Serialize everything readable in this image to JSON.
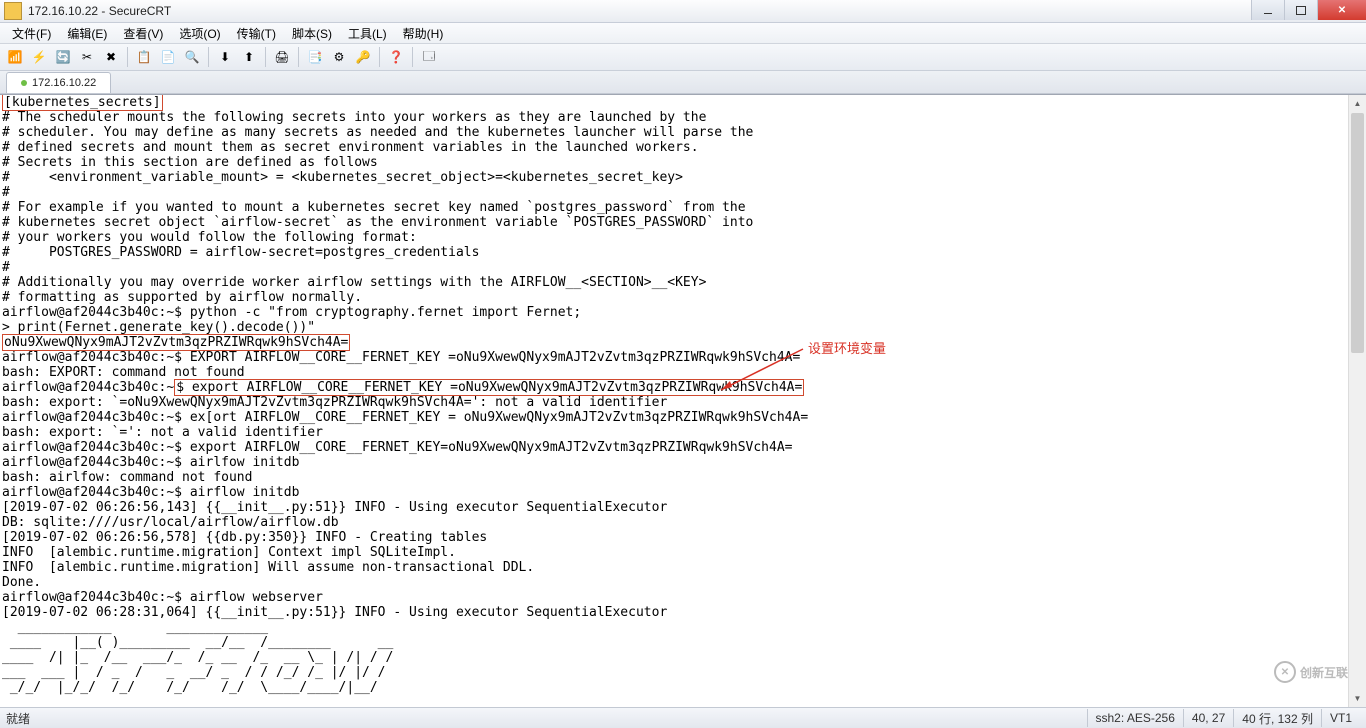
{
  "title": "172.16.10.22 - SecureCRT",
  "menu": [
    "文件(F)",
    "编辑(E)",
    "查看(V)",
    "选项(O)",
    "传输(T)",
    "脚本(S)",
    "工具(L)",
    "帮助(H)"
  ],
  "tab": {
    "label": "172.16.10.22"
  },
  "terminal": {
    "header_line": "[kubernetes_secrets]",
    "comment1": "# The scheduler mounts the following secrets into your workers as they are launched by the",
    "comment2": "# scheduler. You may define as many secrets as needed and the kubernetes launcher will parse the",
    "comment3": "# defined secrets and mount them as secret environment variables in the launched workers.",
    "comment4": "# Secrets in this section are defined as follows",
    "comment5": "#     <environment_variable_mount> = <kubernetes_secret_object>=<kubernetes_secret_key>",
    "comment6": "#",
    "comment7": "# For example if you wanted to mount a kubernetes secret key named `postgres_password` from the",
    "comment8": "# kubernetes secret object `airflow-secret` as the environment variable `POSTGRES_PASSWORD` into",
    "comment9": "# your workers you would follow the following format:",
    "comment10": "#     POSTGRES_PASSWORD = airflow-secret=postgres_credentials",
    "comment11": "#",
    "comment12": "# Additionally you may override worker airflow settings with the AIRFLOW__<SECTION>__<KEY>",
    "comment13": "# formatting as supported by airflow normally.",
    "line_py": "airflow@af2044c3b40c:~$ python -c \"from cryptography.fernet import Fernet;",
    "line_py2": "> print(Fernet.generate_key().decode())\"",
    "boxed_key": "oNu9XwewQNyx9mAJT2vZvtm3qzPRZIWRqwk9hSVch4A=",
    "line_bad1": "airflow@af2044c3b40c:~$ EXPORT AIRFLOW__CORE__FERNET_KEY =oNu9XwewQNyx9mAJT2vZvtm3qzPRZIWRqwk9hSVch4A=",
    "line_bad1_err": "bash: EXPORT: command not found",
    "boxed_export_pre": "airflow@af2044c3b40c:~",
    "boxed_export": "$ export AIRFLOW__CORE__FERNET_KEY =oNu9XwewQNyx9mAJT2vZvtm3qzPRZIWRqwk9hSVch4A=",
    "line_bad2_err": "bash: export: `=oNu9XwewQNyx9mAJT2vZvtm3qzPRZIWRqwk9hSVch4A=': not a valid identifier",
    "line_bad3": "airflow@af2044c3b40c:~$ ex[ort AIRFLOW__CORE__FERNET_KEY = oNu9XwewQNyx9mAJT2vZvtm3qzPRZIWRqwk9hSVch4A=",
    "line_bad3_err": "bash: export: `=': not a valid identifier",
    "line_ok": "airflow@af2044c3b40c:~$ export AIRFLOW__CORE__FERNET_KEY=oNu9XwewQNyx9mAJT2vZvtm3qzPRZIWRqwk9hSVch4A=",
    "line_bad4": "airflow@af2044c3b40c:~$ airlfow initdb",
    "line_bad4_err": "bash: airlfow: command not found",
    "line_init": "airflow@af2044c3b40c:~$ airflow initdb",
    "log1": "[2019-07-02 06:26:56,143] {{__init__.py:51}} INFO - Using executor SequentialExecutor",
    "log2": "DB: sqlite:////usr/local/airflow/airflow.db",
    "log3": "[2019-07-02 06:26:56,578] {{db.py:350}} INFO - Creating tables",
    "log4": "INFO  [alembic.runtime.migration] Context impl SQLiteImpl.",
    "log5": "INFO  [alembic.runtime.migration] Will assume non-transactional DDL.",
    "log6": "Done.",
    "line_web": "airflow@af2044c3b40c:~$ airflow webserver",
    "log7": "[2019-07-02 06:28:31,064] {{__init__.py:51}} INFO - Using executor SequentialExecutor",
    "ascii1": "  ____________       _____________",
    "ascii2": " ____    |__( )_________  __/__  /________      __",
    "ascii3": "____  /| |_  /__  ___/_  /_ __  /_  __ \\_ | /| / /",
    "ascii4": "___  ___ |  / _  /   _  __/ _  / / /_/ /_ |/ |/ /",
    "ascii5": " _/_/  |_/_/  /_/    /_/    /_/  \\____/____/|__/"
  },
  "annotation": "设置环境变量",
  "status": {
    "ready": "就绪",
    "ssh": "ssh2: AES-256",
    "pos": "40,  27",
    "rowcol": "40 行, 132 列",
    "vt": "VT1"
  },
  "watermark": "创新互联"
}
